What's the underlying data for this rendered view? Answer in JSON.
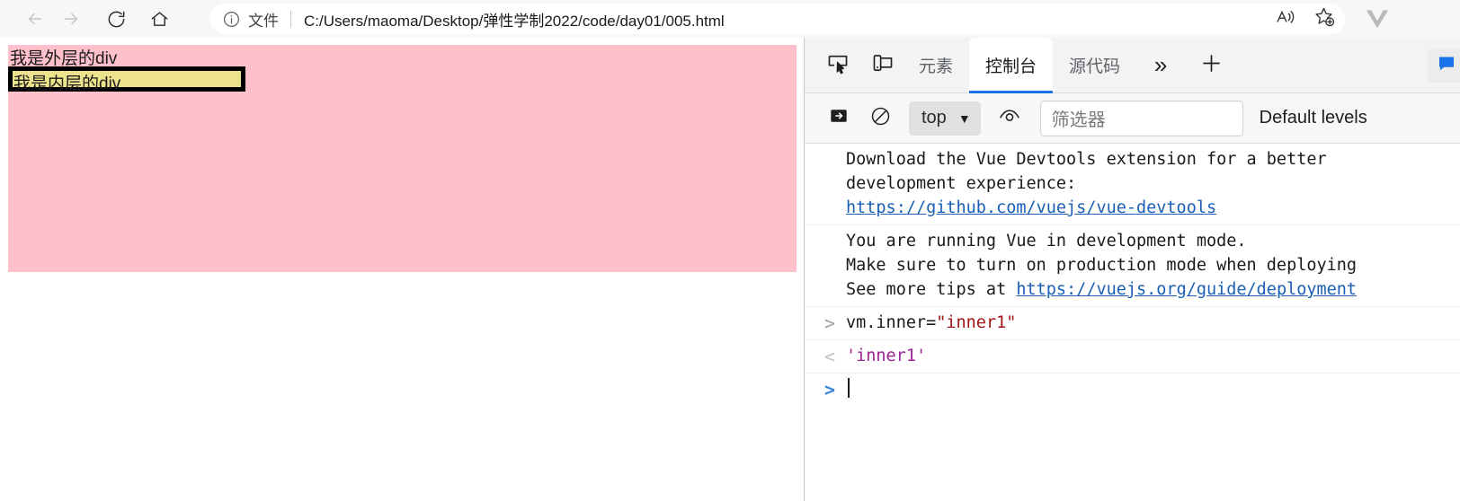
{
  "browser": {
    "nav": {
      "back": "back-arrow",
      "forward": "forward-arrow",
      "reload": "reload",
      "home": "home"
    },
    "address": {
      "scheme_label": "文件",
      "url": "C:/Users/maoma/Desktop/弹性学制2022/code/day01/005.html",
      "info_icon": "info-circle-icon"
    },
    "actions": {
      "read_aloud": "read-aloud-icon",
      "favorites": "add-favorite-icon",
      "extension": "vue-extension-icon"
    }
  },
  "page": {
    "outer_div_text": "我是外层的div",
    "inner_div_text": "我是内层的div",
    "colors": {
      "outer_bg": "#ffc0cb",
      "inner_bg": "#ece38c",
      "inner_border": "#000000"
    }
  },
  "devtools": {
    "tools": {
      "inspect": "inspect-element-icon",
      "device": "device-toolbar-icon",
      "more": "»",
      "add": "+",
      "feedback": "feedback-icon"
    },
    "tabs": [
      {
        "label": "元素",
        "active": false
      },
      {
        "label": "控制台",
        "active": true
      },
      {
        "label": "源代码",
        "active": false
      }
    ],
    "console_toolbar": {
      "sidebar_icon": "console-sidebar-icon",
      "clear_icon": "clear-console-icon",
      "context": "top",
      "context_caret": "▼",
      "eye_icon": "live-expression-icon",
      "filter_placeholder": "筛选器",
      "levels_label": "Default levels"
    },
    "messages": [
      {
        "type": "info",
        "lines": [
          {
            "text": "Download the Vue Devtools extension for a better"
          },
          {
            "text": "development experience:"
          },
          {
            "text": "https://github.com/vuejs/vue-devtools",
            "link": true
          }
        ]
      },
      {
        "type": "info",
        "lines": [
          {
            "text": "You are running Vue in development mode."
          },
          {
            "text": "Make sure to turn on production mode when deploying"
          },
          {
            "text": "See more tips at ",
            "suffix_link": "https://vuejs.org/guide/deployment"
          }
        ]
      }
    ],
    "evaluation": {
      "input_mark": ">",
      "input_prefix": "vm.inner=",
      "input_string": "\"inner1\"",
      "output_mark": "<",
      "output_value": "'inner1'",
      "prompt_mark": ">"
    }
  }
}
